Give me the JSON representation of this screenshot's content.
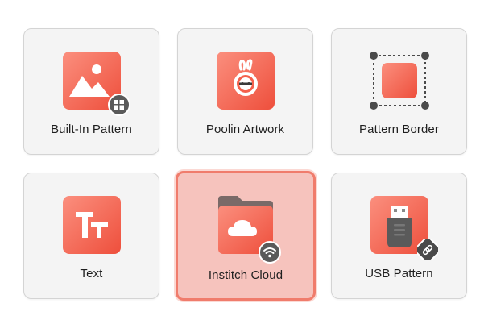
{
  "tiles": [
    {
      "label": "Built-In Pattern",
      "icon": "image-icon",
      "badge": "windows-badge-icon"
    },
    {
      "label": "Poolin Artwork",
      "icon": "poolin-logo-icon"
    },
    {
      "label": "Pattern Border",
      "icon": "border-frame-icon"
    },
    {
      "label": "Text",
      "icon": "text-tt-icon"
    },
    {
      "label": "Institch Cloud",
      "icon": "cloud-folder-icon",
      "badge": "wifi-badge-icon",
      "selected": true
    },
    {
      "label": "USB Pattern",
      "icon": "usb-drive-icon",
      "badge": "link-badge-icon"
    }
  ],
  "colors": {
    "accent": "#f4604c",
    "selected_bg": "#f6c3bd",
    "selected_border": "#f07c6c",
    "tile_bg": "#f4f4f4"
  }
}
